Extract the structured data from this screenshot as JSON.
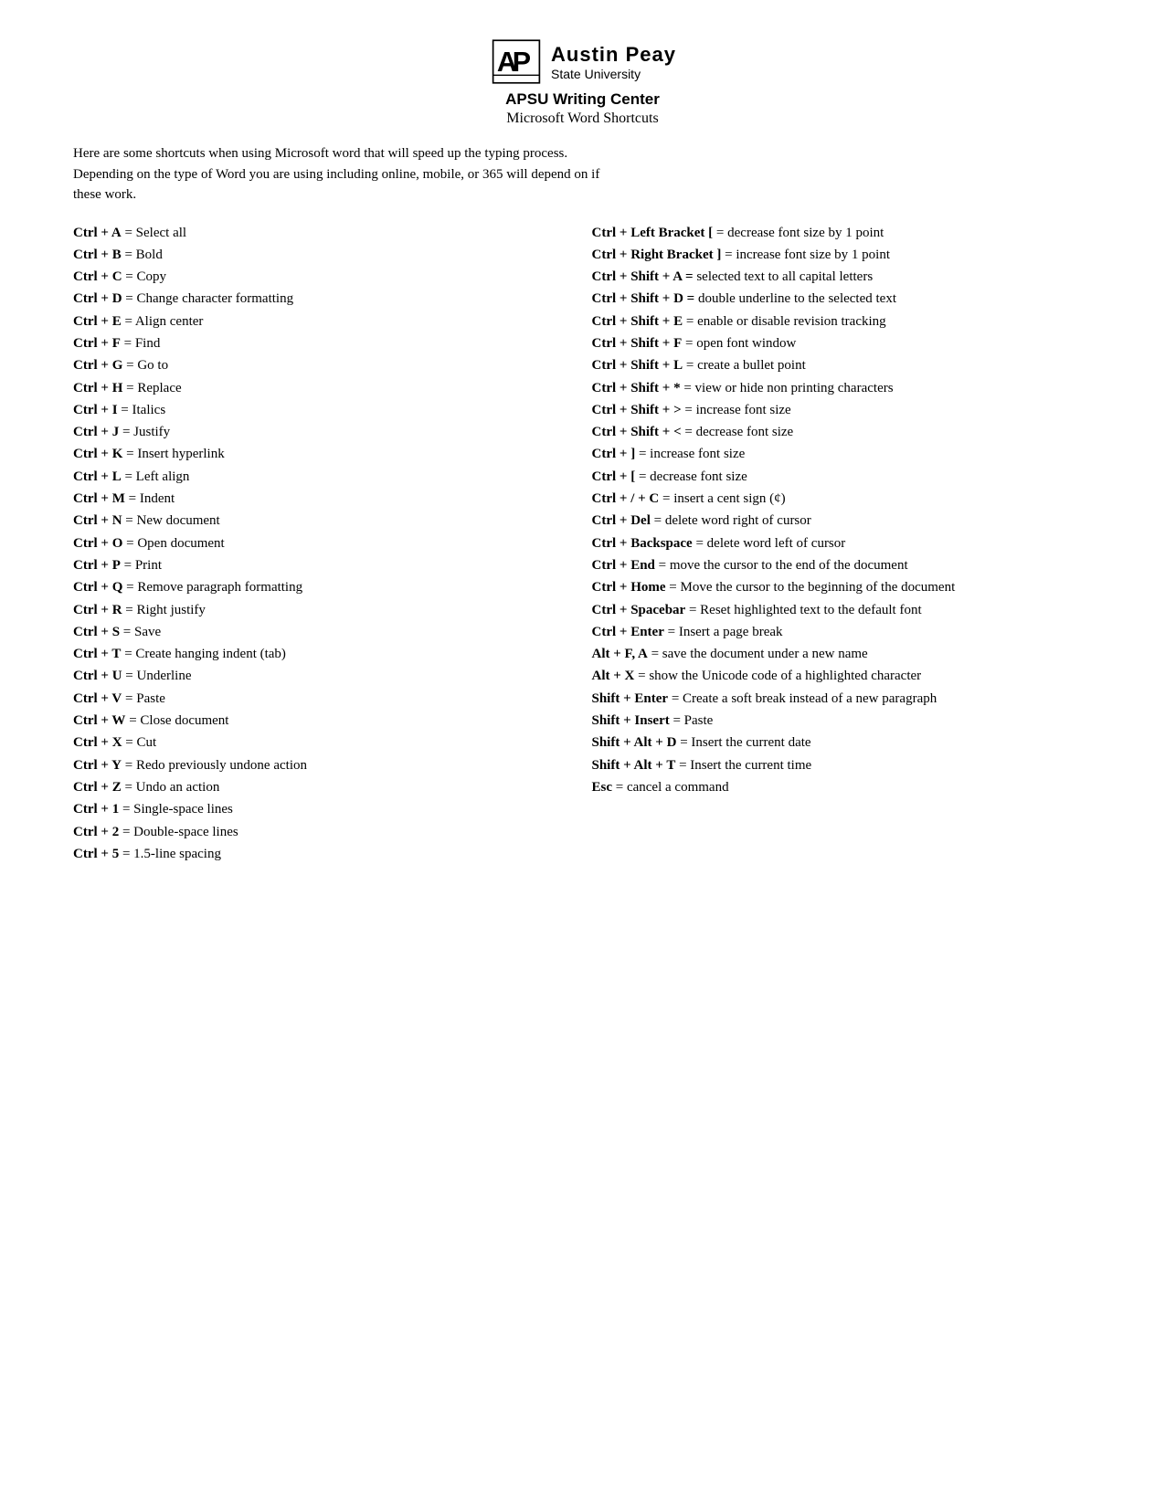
{
  "header": {
    "logo_text_line1": "Austin Peay",
    "logo_text_line2": "State University",
    "center_title": "APSU Writing Center",
    "subtitle": "Microsoft Word Shortcuts"
  },
  "intro": {
    "line1": "Here are some shortcuts when using Microsoft word that will speed up the typing process.",
    "line2": "Depending on the type of Word you are using including online, mobile, or 365 will depend on if",
    "line3": "these work."
  },
  "left_shortcuts": [
    {
      "key": "Ctrl + A",
      "desc": " = Select all"
    },
    {
      "key": "Ctrl + B",
      "desc": " = Bold"
    },
    {
      "key": "Ctrl + C",
      "desc": " = Copy"
    },
    {
      "key": "Ctrl + D",
      "desc": " = Change character formatting"
    },
    {
      "key": "Ctrl + E",
      "desc": " = Align center"
    },
    {
      "key": "Ctrl + F",
      "desc": " = Find"
    },
    {
      "key": "Ctrl + G",
      "desc": " = Go to"
    },
    {
      "key": "Ctrl + H",
      "desc": " = Replace"
    },
    {
      "key": "Ctrl + I",
      "desc": " = Italics"
    },
    {
      "key": "Ctrl + J",
      "desc": " = Justify"
    },
    {
      "key": "Ctrl + K",
      "desc": " = Insert hyperlink"
    },
    {
      "key": "Ctrl + L",
      "desc": " = Left align"
    },
    {
      "key": "Ctrl + M",
      "desc": " = Indent"
    },
    {
      "key": "Ctrl + N",
      "desc": " = New document"
    },
    {
      "key": "Ctrl + O",
      "desc": " = Open document"
    },
    {
      "key": "Ctrl + P",
      "desc": " = Print"
    },
    {
      "key": "Ctrl + Q",
      "desc": " = Remove paragraph formatting"
    },
    {
      "key": "Ctrl + R",
      "desc": " = Right justify"
    },
    {
      "key": "Ctrl + S",
      "desc": " = Save"
    },
    {
      "key": "Ctrl + T",
      "desc": " = Create hanging indent (tab)"
    },
    {
      "key": "Ctrl + U",
      "desc": " = Underline"
    },
    {
      "key": "Ctrl + V",
      "desc": " = Paste"
    },
    {
      "key": "Ctrl + W",
      "desc": " = Close document"
    },
    {
      "key": "Ctrl + X",
      "desc": " = Cut"
    },
    {
      "key": "Ctrl + Y",
      "desc": " = Redo previously undone action"
    },
    {
      "key": "Ctrl + Z",
      "desc": " = Undo an action"
    },
    {
      "key": "Ctrl + 1",
      "desc": " = Single-space lines"
    },
    {
      "key": "Ctrl + 2",
      "desc": " = Double-space lines"
    },
    {
      "key": "Ctrl + 5",
      "desc": " = 1.5-line spacing"
    }
  ],
  "right_shortcuts": [
    {
      "key": "Ctrl + Left Bracket [",
      "desc": " = decrease font size by 1 point"
    },
    {
      "key": "Ctrl + Right Bracket ]",
      "desc": " = increase font size by 1 point"
    },
    {
      "key": "Ctrl + Shift + A = ",
      "desc": " selected text to all capital letters"
    },
    {
      "key": "Ctrl + Shift + D = ",
      "desc": " double underline to the selected text"
    },
    {
      "key": "Ctrl + Shift + E",
      "desc": " = enable or disable revision tracking"
    },
    {
      "key": "Ctrl + Shift + F",
      "desc": " = open font window"
    },
    {
      "key": "Ctrl + Shift + L",
      "desc": " = create a bullet point"
    },
    {
      "key": "Ctrl + Shift + *",
      "desc": " = view or hide non printing characters"
    },
    {
      "key": "Ctrl + Shift + >",
      "desc": " = increase font size"
    },
    {
      "key": "Ctrl + Shift + <",
      "desc": " = decrease font size"
    },
    {
      "key": "Ctrl + ]",
      "desc": " = increase font size"
    },
    {
      "key": "Ctrl + [",
      "desc": " = decrease font size"
    },
    {
      "key": "Ctrl + / + C",
      "desc": " = insert a cent sign (¢)"
    },
    {
      "key": "Ctrl + Del",
      "desc": " = delete word right of cursor"
    },
    {
      "key": "Ctrl + Backspace",
      "desc": " = delete word left of cursor"
    },
    {
      "key": "Ctrl + End",
      "desc": " = move the cursor to the end of the document"
    },
    {
      "key": "Ctrl + Home",
      "desc": " = Move the cursor to the beginning of the document"
    },
    {
      "key": "Ctrl + Spacebar",
      "desc": " = Reset highlighted text to the default font"
    },
    {
      "key": "Ctrl + Enter",
      "desc": " = Insert a page break"
    },
    {
      "key": "Alt + F, A",
      "desc": " = save the document under a new name"
    },
    {
      "key": "Alt + X",
      "desc": " = show the Unicode code of a highlighted character"
    },
    {
      "key": "Shift + Enter",
      "desc": " = Create a soft break instead of a new paragraph"
    },
    {
      "key": "Shift + Insert",
      "desc": " = Paste"
    },
    {
      "key": "Shift + Alt + D",
      "desc": " = Insert the current date"
    },
    {
      "key": "Shift + Alt + T",
      "desc": " = Insert the current time"
    },
    {
      "key": "Esc",
      "desc": " = cancel a command"
    }
  ]
}
